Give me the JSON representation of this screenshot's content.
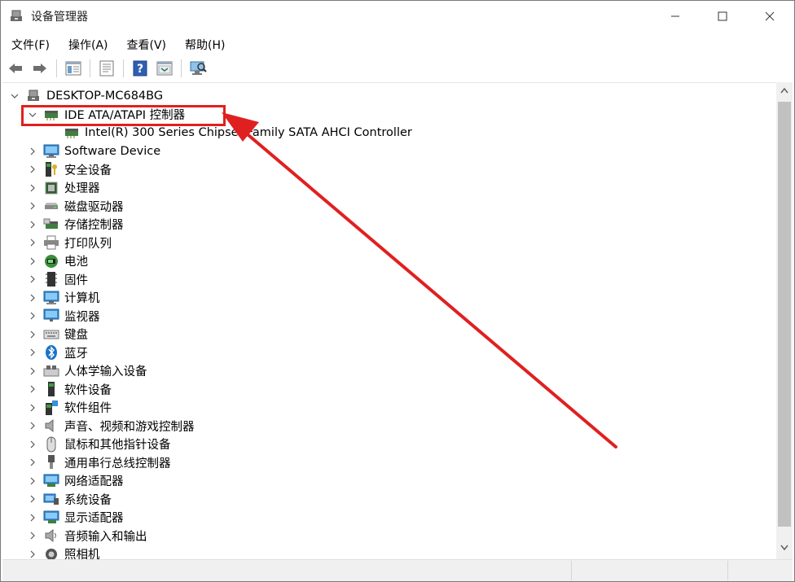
{
  "window": {
    "title": "设备管理器",
    "app_icon": "device-manager-icon"
  },
  "menubar": {
    "items": [
      "文件(F)",
      "操作(A)",
      "查看(V)",
      "帮助(H)"
    ]
  },
  "toolbar": {
    "buttons": [
      "back-arrow-icon",
      "forward-arrow-icon",
      "properties-icon",
      "update-driver-icon",
      "help-icon",
      "show-hide-icon",
      "scan-hardware-icon"
    ]
  },
  "tree": {
    "root": "DESKTOP-MC684BG",
    "ide_group": "IDE ATA/ATAPI 控制器",
    "ide_child": "Intel(R) 300 Series Chipset Family SATA AHCI Controller",
    "categories": [
      {
        "label": "Software Device",
        "icon": "software-device-icon"
      },
      {
        "label": "安全设备",
        "icon": "security-device-icon"
      },
      {
        "label": "处理器",
        "icon": "processor-icon"
      },
      {
        "label": "磁盘驱动器",
        "icon": "disk-drive-icon"
      },
      {
        "label": "存储控制器",
        "icon": "storage-controller-icon"
      },
      {
        "label": "打印队列",
        "icon": "printer-icon"
      },
      {
        "label": "电池",
        "icon": "battery-icon"
      },
      {
        "label": "固件",
        "icon": "firmware-icon"
      },
      {
        "label": "计算机",
        "icon": "computer-icon"
      },
      {
        "label": "监视器",
        "icon": "monitor-icon"
      },
      {
        "label": "键盘",
        "icon": "keyboard-icon"
      },
      {
        "label": "蓝牙",
        "icon": "bluetooth-icon"
      },
      {
        "label": "人体学输入设备",
        "icon": "hid-icon"
      },
      {
        "label": "软件设备",
        "icon": "software-device2-icon"
      },
      {
        "label": "软件组件",
        "icon": "software-component-icon"
      },
      {
        "label": "声音、视频和游戏控制器",
        "icon": "sound-icon"
      },
      {
        "label": "鼠标和其他指针设备",
        "icon": "mouse-icon"
      },
      {
        "label": "通用串行总线控制器",
        "icon": "usb-icon"
      },
      {
        "label": "网络适配器",
        "icon": "network-adapter-icon"
      },
      {
        "label": "系统设备",
        "icon": "system-device-icon"
      },
      {
        "label": "显示适配器",
        "icon": "display-adapter-icon"
      },
      {
        "label": "音频输入和输出",
        "icon": "audio-io-icon"
      },
      {
        "label": "照相机",
        "icon": "camera-icon"
      }
    ]
  },
  "colors": {
    "annotation_red": "#e02020",
    "accent_blue": "#1a73c7"
  }
}
